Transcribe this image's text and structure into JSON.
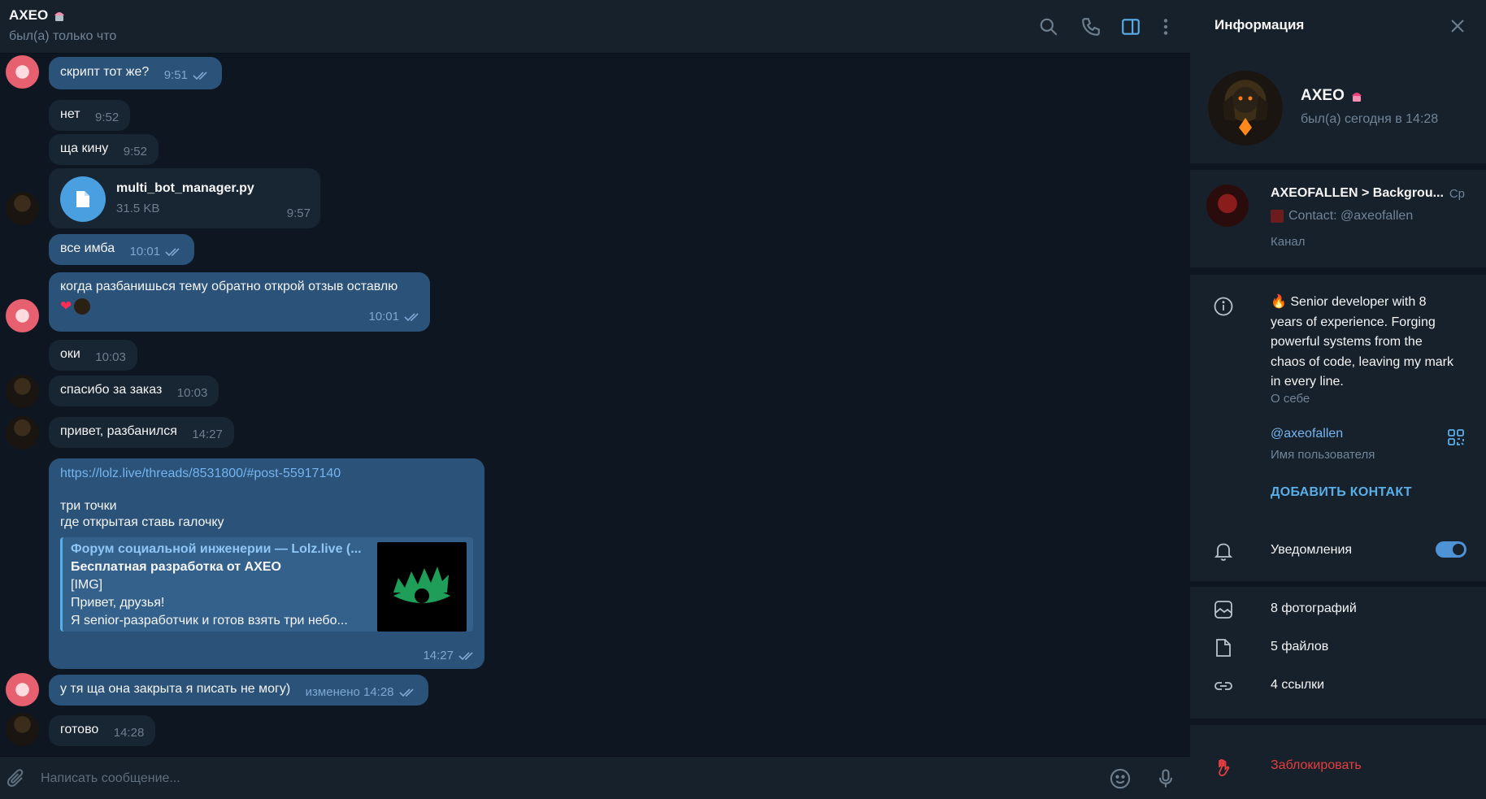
{
  "chat": {
    "title": "AXEO",
    "status": "был(а) только что"
  },
  "messages": [
    {
      "kind": "out",
      "text": "скрипт тот же?",
      "time": "9:51",
      "read": true
    },
    {
      "kind": "in",
      "text": "нет",
      "time": "9:52"
    },
    {
      "kind": "in",
      "text": "ща кину",
      "time": "9:52"
    },
    {
      "kind": "file",
      "file_name": "multi_bot_manager.py",
      "file_size": "31.5 KB",
      "time": "9:57"
    },
    {
      "kind": "out",
      "text": "все имба",
      "time": "10:01",
      "read": true
    },
    {
      "kind": "out",
      "text": "когда разбанишься тему обратно открой отзыв оставлю",
      "time": "10:01",
      "read": true,
      "reaction": "❤"
    },
    {
      "kind": "in",
      "text": "оки",
      "time": "10:03"
    },
    {
      "kind": "in",
      "text": "спасибо за заказ",
      "time": "10:03"
    },
    {
      "kind": "in",
      "text": "привет, разбанился",
      "time": "14:27"
    },
    {
      "kind": "link",
      "url": "https://lolz.live/threads/8531800/#post-55917140",
      "line1": "три точки",
      "line2": "где открытая ставь галочку",
      "preview_site": "Форум социальной инженерии — Lolz.live (...",
      "preview_title": "Бесплатная разработка от AXEO",
      "preview_line1": "[IMG]",
      "preview_line2": "Привет, друзья!",
      "preview_line3": "Я senior-разработчик и готов взять три небо...",
      "time": "14:27",
      "read": true
    },
    {
      "kind": "out",
      "text": "у тя ща она закрыта я писать не могу)",
      "edited": "изменено 14:28",
      "read": true
    },
    {
      "kind": "in",
      "text": "готово",
      "time": "14:28"
    }
  ],
  "composer": {
    "placeholder": "Написать сообщение..."
  },
  "info": {
    "title": "Информация",
    "profile_name": "AXEO",
    "profile_status": "был(а) сегодня в 14:28",
    "channel_name": "AXEOFALLEN > Backgrou...",
    "channel_day": "Ср",
    "channel_contact": "Contact: @axeofallen",
    "channel_type": "Канал",
    "about": "🔥 Senior developer with 8 years of experience. Forging powerful systems from the chaos of code, leaving my mark in every line.",
    "about_label": "О себе",
    "username": "@axeofallen",
    "username_label": "Имя пользователя",
    "add_contact": "ДОБАВИТЬ КОНТАКТ",
    "notifications": "Уведомления",
    "notifications_on": true,
    "photos": "8 фотографий",
    "files": "5 файлов",
    "links": "4 ссылки",
    "block": "Заблокировать"
  },
  "colors": {
    "bg": "#0e1621",
    "panel": "#17212b",
    "outgoing": "#2b5278",
    "incoming": "#182533",
    "accent": "#5aaee8",
    "danger": "#e53e3e"
  }
}
